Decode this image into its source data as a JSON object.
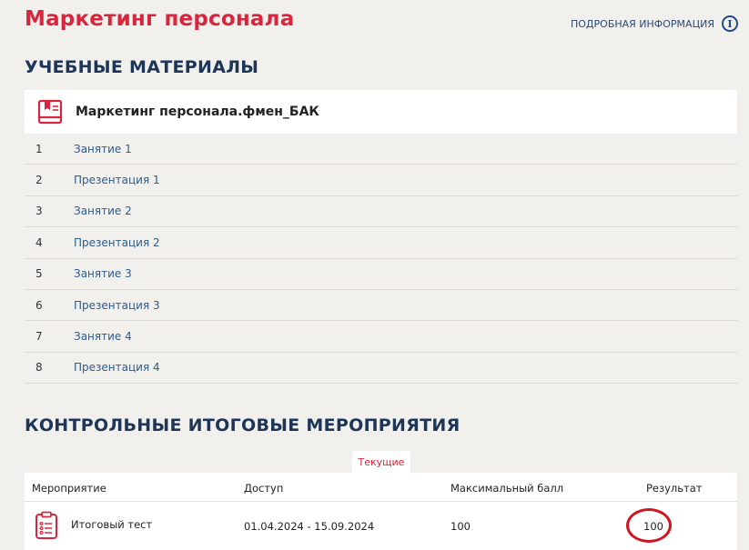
{
  "header": {
    "title": "Маркетинг персонала",
    "info_link": "ПОДРОБНАЯ ИНФОРМАЦИЯ",
    "info_icon": "i"
  },
  "materials": {
    "heading": "УЧЕБНЫЕ МАТЕРИАЛЫ",
    "course_name": "Маркетинг персонала.фмен_БАК",
    "items": [
      {
        "num": "1",
        "label": "Занятие 1"
      },
      {
        "num": "2",
        "label": "Презентация 1"
      },
      {
        "num": "3",
        "label": "Занятие 2"
      },
      {
        "num": "4",
        "label": "Презентация 2"
      },
      {
        "num": "5",
        "label": "Занятие 3"
      },
      {
        "num": "6",
        "label": "Презентация 3"
      },
      {
        "num": "7",
        "label": "Занятие 4"
      },
      {
        "num": "8",
        "label": "Презентация 4"
      }
    ]
  },
  "events": {
    "heading": "КОНТРОЛЬНЫЕ ИТОГОВЫЕ МЕРОПРИЯТИЯ",
    "tab_current": "Текущие",
    "columns": {
      "event": "Мероприятие",
      "access": "Доступ",
      "max_score": "Максимальный балл",
      "result": "Результат"
    },
    "rows": [
      {
        "event": "Итоговый тест",
        "access": "01.04.2024 - 15.09.2024",
        "max_score": "100",
        "result": "100"
      }
    ]
  },
  "colors": {
    "accent_red": "#d7263d",
    "heading_navy": "#1d3557",
    "link_blue": "#2b5d8c",
    "annotation_circle": "#d2141f"
  },
  "icons": {
    "book": "book-icon",
    "info": "info-icon",
    "test": "clipboard-list-icon"
  }
}
